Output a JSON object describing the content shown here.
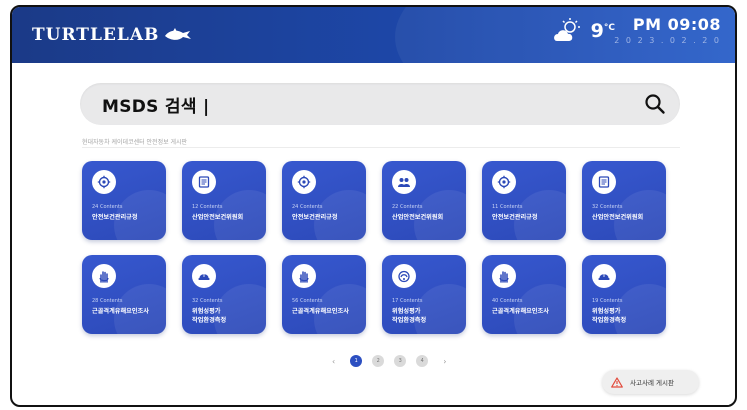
{
  "header": {
    "logo_text": "TURTLELAB",
    "temperature": "9",
    "temp_unit": "°C",
    "time": "PM 09:08",
    "date": "2 0 2 3 . 0 2 . 2 0",
    "weather_icon": "partly-cloudy-night-icon"
  },
  "search": {
    "value": "MSDS 검색 |",
    "icon": "search-icon"
  },
  "breadcrumb": "현대자동차 케이데코센터 안전정보 게시판",
  "cards": [
    {
      "count": "24 Contents",
      "title": "안전보건관리규정",
      "icon": "gear-shield-icon"
    },
    {
      "count": "12 Contents",
      "title": "산업안전보건위원회",
      "icon": "document-board-icon"
    },
    {
      "count": "24 Contents",
      "title": "안전보건관리규정",
      "icon": "gear-shield-icon"
    },
    {
      "count": "22 Contents",
      "title": "산업안전보건위원회",
      "icon": "team-gear-icon"
    },
    {
      "count": "11 Contents",
      "title": "안전보건관리규정",
      "icon": "gear-shield-icon"
    },
    {
      "count": "32 Contents",
      "title": "산업안전보건위원회",
      "icon": "document-board-icon"
    },
    {
      "count": "28 Contents",
      "title": "근골격계유해요인조사",
      "icon": "hand-icon"
    },
    {
      "count": "32 Contents",
      "title": "위험성평가\n작업환경측정",
      "icon": "hardhat-icon"
    },
    {
      "count": "56 Contents",
      "title": "근골격계유해요인조사",
      "icon": "hand-icon"
    },
    {
      "count": "17 Contents",
      "title": "위험성평가\n작업환경측정",
      "icon": "helmet-icon"
    },
    {
      "count": "40 Contents",
      "title": "근골격계유해요인조사",
      "icon": "hand-icon"
    },
    {
      "count": "19 Contents",
      "title": "위험성평가\n작업환경측정",
      "icon": "hardhat-icon"
    }
  ],
  "pagination": {
    "prev": "‹",
    "next": "›",
    "pages": [
      "1",
      "2",
      "3",
      "4"
    ],
    "current": "1"
  },
  "report_button": {
    "label": "사고사례 게시판",
    "icon": "warning-icon"
  },
  "colors": {
    "header": "#1d47a8",
    "card": "#3758cf",
    "accent": "#2c4fc1"
  }
}
